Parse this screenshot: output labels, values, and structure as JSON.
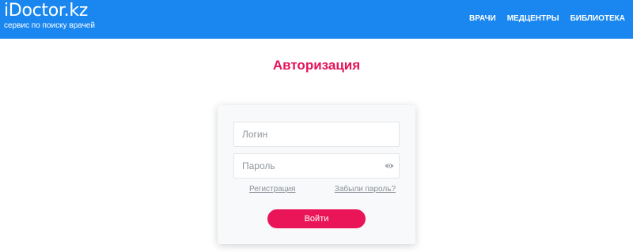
{
  "header": {
    "logo_text": "iDoctor.kz",
    "logo_tagline": "сервис по поиску врачей",
    "nav": [
      {
        "label": "ВРАЧИ"
      },
      {
        "label": "МЕДЦЕНТРЫ"
      },
      {
        "label": "БИБЛИОТЕКА"
      }
    ],
    "background_color": "#1a87f0"
  },
  "page": {
    "title": "Авторизация",
    "title_color": "#e4145a"
  },
  "form": {
    "login_placeholder": "Логин",
    "login_value": "",
    "password_placeholder": "Пароль",
    "password_value": "",
    "password_toggle_icon": "eye-icon",
    "register_link": "Регистрация",
    "forgot_link": "Забыли пароль?",
    "submit_label": "Войти",
    "submit_color": "#ea1559"
  }
}
